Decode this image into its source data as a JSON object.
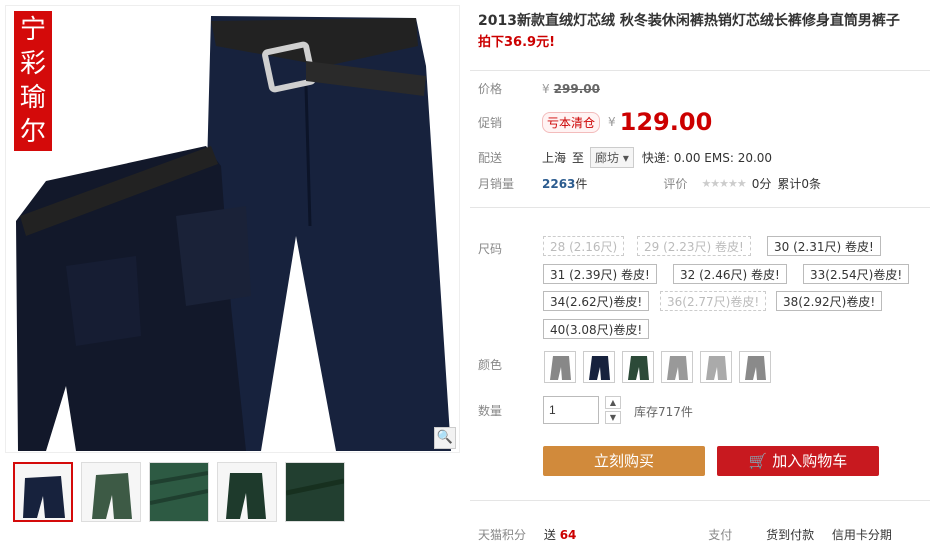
{
  "product": {
    "title": "2013新款直绒灯芯绒 秋冬装休闲裤热销灯芯绒长裤修身直筒男裤子",
    "promo_title": "拍下36.9元!",
    "seal_text": [
      "宁",
      "彩",
      "瑜",
      "尔"
    ],
    "zoom_icon": "magnifier-icon"
  },
  "price": {
    "label": "价格",
    "currency": "¥",
    "original": "299.00"
  },
  "promotion": {
    "label": "促销",
    "badge": "亏本清仓",
    "currency": "¥",
    "value": "129.00"
  },
  "shipping": {
    "label": "配送",
    "from": "上海",
    "to_word": "至",
    "to_city": "廊坊",
    "fees": "快递: 0.00 EMS: 20.00"
  },
  "sales": {
    "label": "月销量",
    "count": "2263",
    "unit": "件",
    "rating_label": "评价",
    "stars": "★★★★★",
    "score": "0分",
    "reviews": "累计0条"
  },
  "size": {
    "label": "尺码",
    "options": [
      "28 (2.16尺)",
      "29 (2.23尺) 卷皮!",
      "30 (2.31尺) 卷皮!",
      "31 (2.39尺) 卷皮!",
      "32 (2.46尺) 卷皮!",
      "33(2.54尺)卷皮!",
      "34(2.62尺)卷皮!",
      "36(2.77尺)卷皮!",
      "38(2.92尺)卷皮!",
      "40(3.08尺)卷皮!"
    ],
    "disabled": [
      true,
      true,
      false,
      false,
      false,
      false,
      false,
      true,
      false,
      false
    ]
  },
  "color": {
    "label": "颜色"
  },
  "quantity": {
    "label": "数量",
    "value": "1",
    "stock": "库存717件"
  },
  "actions": {
    "buy_now": "立刻购买",
    "add_cart": "加入购物车"
  },
  "bottom": {
    "points_label": "天猫积分",
    "points_prefix": "送",
    "points_value": "64",
    "pay_label": "支付",
    "cod": "货到付款",
    "credit": "信用卡分期"
  },
  "colors": {
    "accent_red": "#c00000",
    "buy_orange": "#d18a3b",
    "cart_red": "#c8191f",
    "pants_navy": "#17223d",
    "pants_green": "#2c4a38"
  }
}
